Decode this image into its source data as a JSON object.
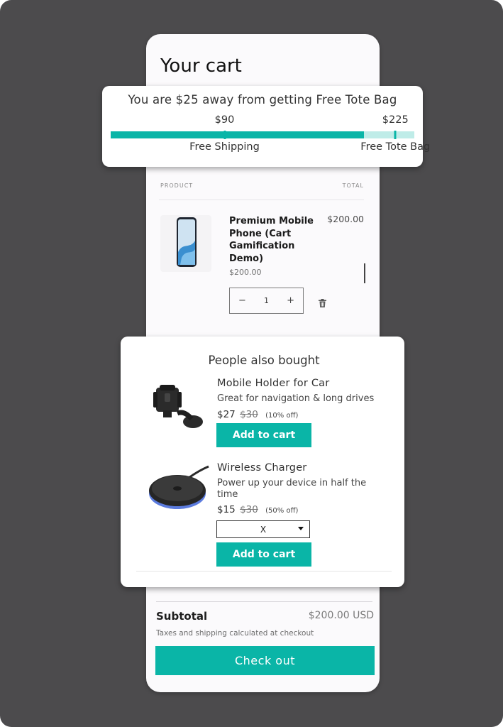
{
  "cart": {
    "title": "Your cart",
    "col_product": "PRODUCT",
    "col_total": "TOTAL",
    "item": {
      "name": "Premium Mobile Phone (Cart Gamification Demo)",
      "unit_price": "$200.00",
      "total": "$200.00",
      "quantity": "1",
      "minus": "−",
      "plus": "+"
    },
    "subtotal_label": "Subtotal",
    "subtotal_value": "$200.00 USD",
    "tax_note": "Taxes and shipping calculated at checkout",
    "checkout_label": "Check out"
  },
  "progress": {
    "message": "You are $25 away from getting Free Tote Bag",
    "max_amount": 240,
    "current_amount": 200,
    "milestones": [
      {
        "amount": 90,
        "amount_label": "$90",
        "label": "Free Shipping"
      },
      {
        "amount": 225,
        "amount_label": "$225",
        "label": "Free Tote Bag"
      }
    ],
    "colors": {
      "fill": "#0ab5a7",
      "track": "#bfece8"
    }
  },
  "upsell": {
    "title": "People also bought",
    "items": [
      {
        "name": "Mobile Holder for Car",
        "description": "Great for navigation & long drives",
        "price": "$27",
        "compare_price": "$30",
        "discount": "(10% off)",
        "button": "Add to cart"
      },
      {
        "name": "Wireless Charger",
        "description": "Power up your device in half the time",
        "price": "$15",
        "compare_price": "$30",
        "discount": "(50% off)",
        "variant": "X",
        "button": "Add to cart"
      }
    ]
  },
  "colors": {
    "accent": "#0ab5a7",
    "frame": "#4c4b4d"
  }
}
